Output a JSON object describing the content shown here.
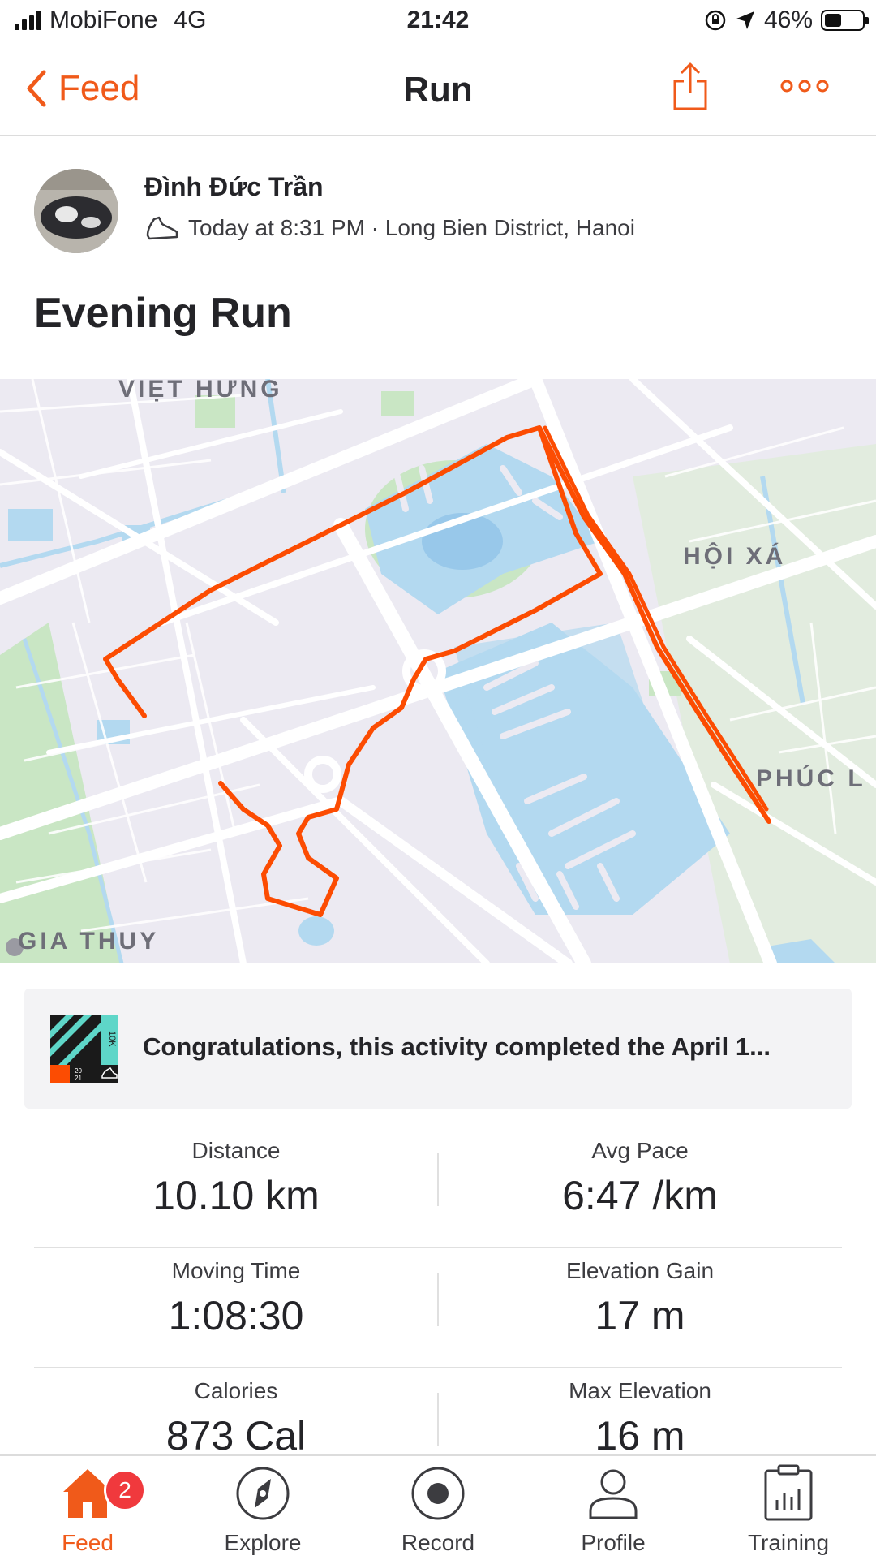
{
  "status_bar": {
    "carrier": "MobiFone",
    "network": "4G",
    "time": "21:42",
    "battery": "46%"
  },
  "nav": {
    "back_label": "Feed",
    "title": "Run"
  },
  "athlete": {
    "name": "Đình Đức Trần",
    "meta": "Today at 8:31 PM · Long Bien District, Hanoi"
  },
  "activity": {
    "title": "Evening Run"
  },
  "map": {
    "labels": {
      "viet_hung": "VIỆT HƯNG",
      "hoi_xa": "HỘI XÁ",
      "phuc_l": "PHÚC L",
      "gia_thuy": "GIA THUY"
    },
    "route_color": "#fc4c02"
  },
  "challenge": {
    "text": "Congratulations, this activity completed the April 1...",
    "badge_label": "10K",
    "badge_year_top": "20",
    "badge_year_bottom": "21"
  },
  "stats": [
    [
      {
        "label": "Distance",
        "value": "10.10 km"
      },
      {
        "label": "Avg Pace",
        "value": "6:47 /km"
      }
    ],
    [
      {
        "label": "Moving Time",
        "value": "1:08:30"
      },
      {
        "label": "Elevation Gain",
        "value": "17 m"
      }
    ],
    [
      {
        "label": "Calories",
        "value": "873 Cal"
      },
      {
        "label": "Max Elevation",
        "value": "16 m"
      }
    ]
  ],
  "tabs": [
    {
      "label": "Feed",
      "badge": "2"
    },
    {
      "label": "Explore"
    },
    {
      "label": "Record"
    },
    {
      "label": "Profile"
    },
    {
      "label": "Training"
    }
  ],
  "colors": {
    "accent": "#f05a1a",
    "notification": "#f0393d",
    "water": "#b3d9f0",
    "park": "#c9e6c4"
  }
}
